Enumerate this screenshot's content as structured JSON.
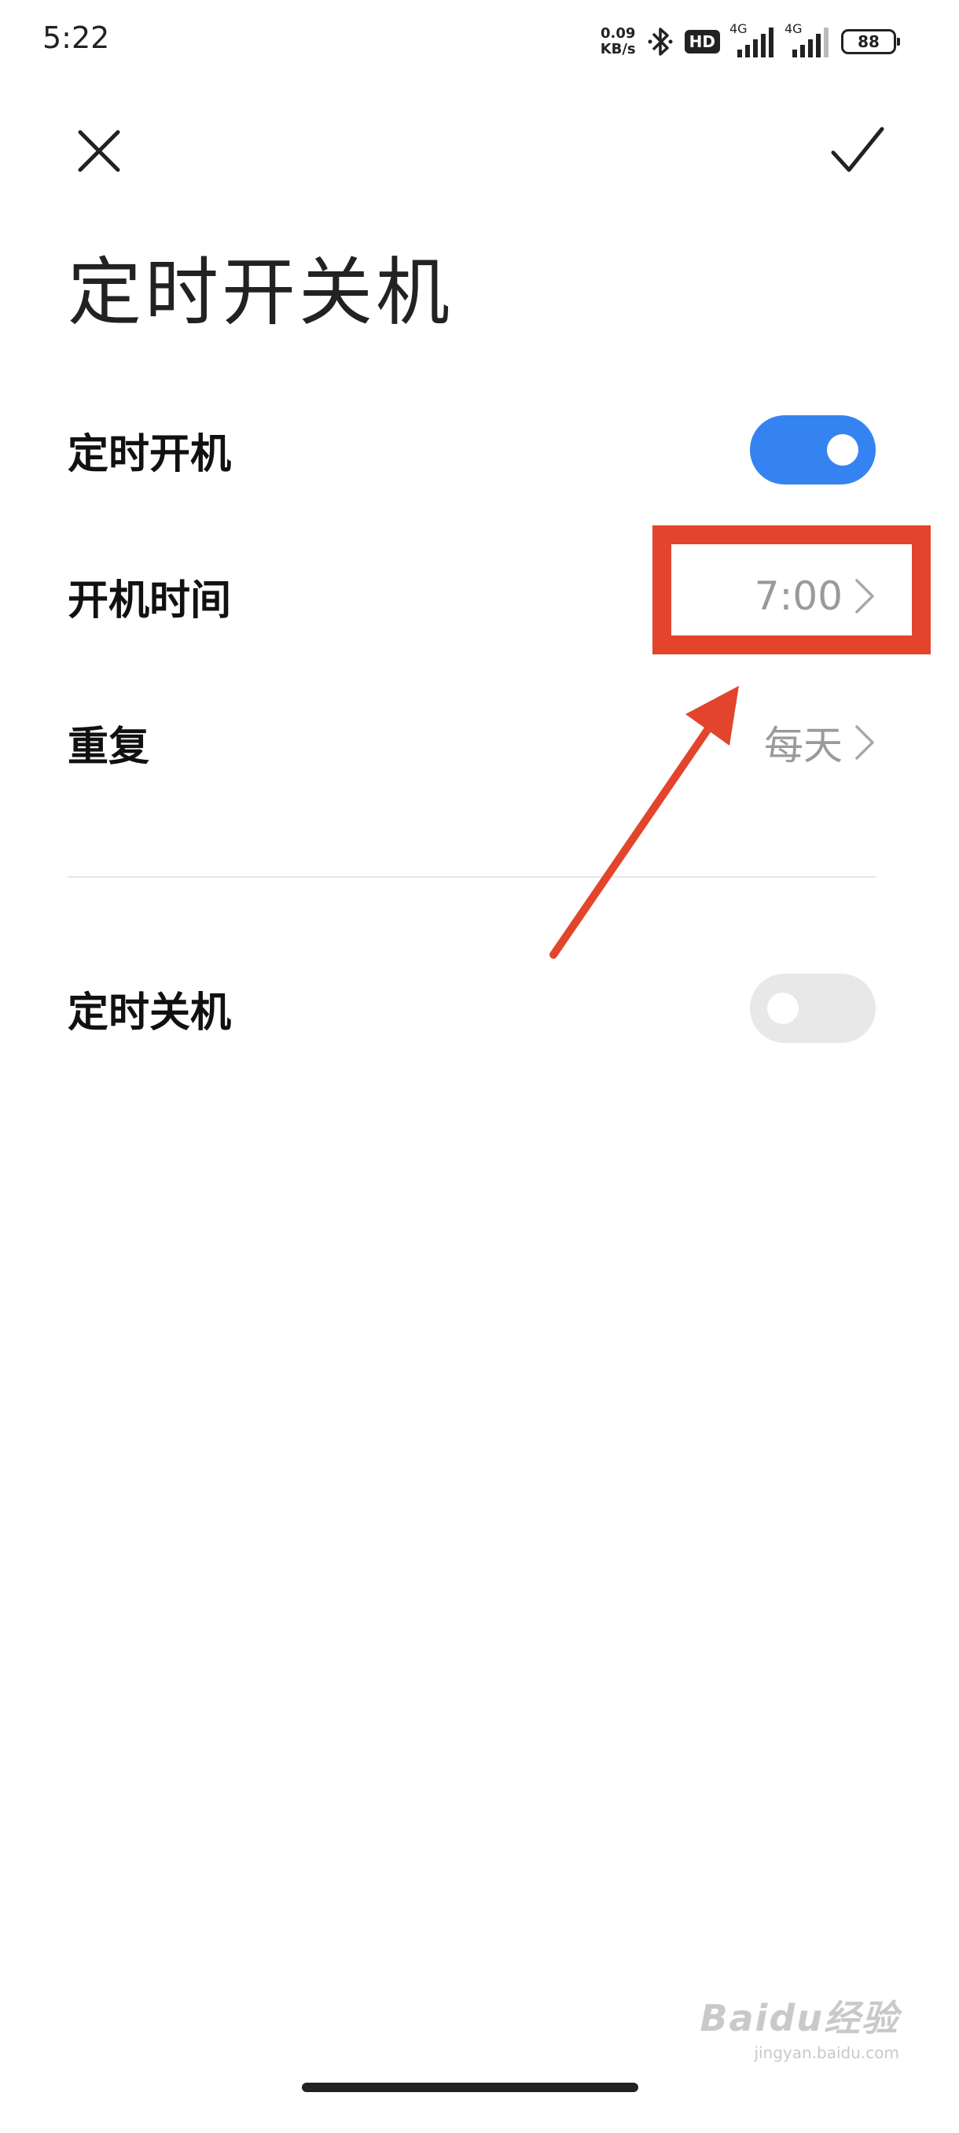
{
  "status_bar": {
    "time": "5:22",
    "net_speed_value": "0.09",
    "net_speed_unit": "KB/s",
    "hd_label": "HD",
    "signal1_label": "4G",
    "signal2_label": "4G",
    "battery": "88",
    "icons": [
      "bluetooth-icon",
      "hd-icon",
      "signal-icon",
      "signal-icon",
      "battery-icon"
    ]
  },
  "toolbar": {
    "close_icon": "close-icon",
    "confirm_icon": "check-icon"
  },
  "page": {
    "title": "定时开关机"
  },
  "power_on": {
    "label": "定时开机",
    "enabled": true
  },
  "power_on_time": {
    "label": "开机时间",
    "value": "7:00"
  },
  "repeat": {
    "label": "重复",
    "value": "每天"
  },
  "power_off": {
    "label": "定时关机",
    "enabled": false
  },
  "colors": {
    "accent": "#3583f0",
    "toggle_off": "#e8e8e8",
    "annotation": "#e2452c",
    "value_text": "#9a9a9a"
  },
  "watermark": {
    "main": "Baidu经验",
    "sub": "jingyan.baidu.com"
  }
}
